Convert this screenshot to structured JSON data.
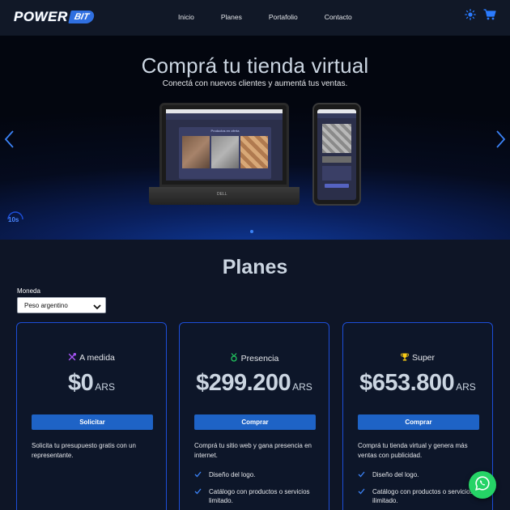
{
  "brand": {
    "logo_text": "POWER",
    "logo_badge": "BIT"
  },
  "nav": {
    "items": [
      {
        "label": "Inicio"
      },
      {
        "label": "Planes"
      },
      {
        "label": "Portafolio"
      },
      {
        "label": "Contacto"
      }
    ]
  },
  "header_icons": [
    "sun-icon",
    "cart-icon"
  ],
  "hero": {
    "title": "Comprá tu tienda virtual",
    "subtitle": "Conectá con nuevos clientes y aumentá tus ventas.",
    "timer": "10s",
    "mockup": {
      "laptop_title": "Productos en oferta",
      "laptop_brand": "DELL"
    }
  },
  "plans": {
    "title": "Planes",
    "currency_label": "Moneda",
    "currency_value": "Peso argentino",
    "cards": [
      {
        "icon": "tools-icon",
        "name": "A medida",
        "price": "$0",
        "currency": "ARS",
        "button": "Solicitar",
        "description": "Solicita tu presupuesto gratis con un representante.",
        "features": []
      },
      {
        "icon": "medal-icon",
        "name": "Presencia",
        "price": "$299.200",
        "currency": "ARS",
        "button": "Comprar",
        "description": "Comprá tu sitio web y gana presencia en internet.",
        "features": [
          "Diseño del logo.",
          "Catálogo con productos o servicios limitado."
        ]
      },
      {
        "icon": "trophy-icon",
        "name": "Super",
        "price": "$653.800",
        "currency": "ARS",
        "button": "Comprar",
        "description": "Comprá tu tienda virtual y genera más ventas con publicidad.",
        "features": [
          "Diseño del logo.",
          "Catálogo con productos o servicios ilimitado."
        ]
      }
    ]
  },
  "colors": {
    "accent": "#1e63c6",
    "brand_blue": "#2f6fe0",
    "card_border": "#1d4ed8",
    "whatsapp": "#25d366"
  }
}
